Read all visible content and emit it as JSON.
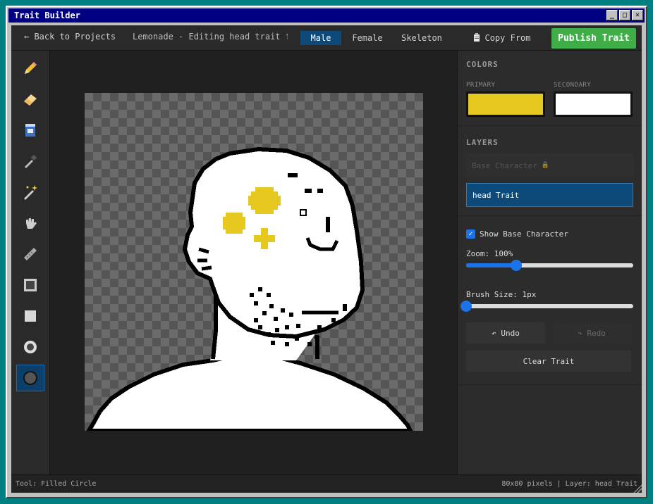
{
  "window": {
    "title": "Trait Builder",
    "controls": {
      "minimize": "_",
      "maximize": "□",
      "close": "✕"
    }
  },
  "topbar": {
    "back": "← Back to Projects",
    "project_title": "Lemonade - Editing head trait for ...",
    "body_types": [
      "Male",
      "Female",
      "Skeleton"
    ],
    "active_body_type": "Male",
    "copy_from": "Copy From",
    "publish": "Publish Trait"
  },
  "tools": [
    {
      "name": "pencil-tool-icon",
      "active": false
    },
    {
      "name": "eraser-tool-icon",
      "active": false
    },
    {
      "name": "fill-bucket-tool-icon",
      "active": false
    },
    {
      "name": "eyedropper-tool-icon",
      "active": false
    },
    {
      "name": "magic-wand-tool-icon",
      "active": false
    },
    {
      "name": "move-hand-tool-icon",
      "active": false
    },
    {
      "name": "line-tool-icon",
      "active": false
    },
    {
      "name": "rectangle-outline-tool-icon",
      "active": false
    },
    {
      "name": "filled-rectangle-tool-icon",
      "active": false
    },
    {
      "name": "circle-outline-tool-icon",
      "active": false
    },
    {
      "name": "filled-circle-tool-icon",
      "active": true
    }
  ],
  "panel": {
    "colors_title": "COLORS",
    "primary_label": "PRIMARY",
    "secondary_label": "SECONDARY",
    "primary_color": "#e7c81f",
    "secondary_color": "#ffffff",
    "layers_title": "LAYERS",
    "layers": [
      {
        "label": "Base Character",
        "locked": true,
        "selected": false
      },
      {
        "label": "head Trait",
        "locked": false,
        "selected": true
      }
    ],
    "lock_icon": "🔒",
    "show_base_label": "Show Base Character",
    "show_base_checked": true,
    "zoom_label": "Zoom: 100%",
    "zoom_fraction": 0.3,
    "brush_label": "Brush Size: 1px",
    "brush_fraction": 0.0,
    "undo": "↶ Undo",
    "redo": "↷ Redo",
    "clear": "Clear Trait"
  },
  "status": {
    "tool": "Tool: Filled Circle",
    "info": "80x80 pixels | Layer: head Trait"
  },
  "accent_color": "#0d4a7a",
  "publish_color": "#3fae49"
}
